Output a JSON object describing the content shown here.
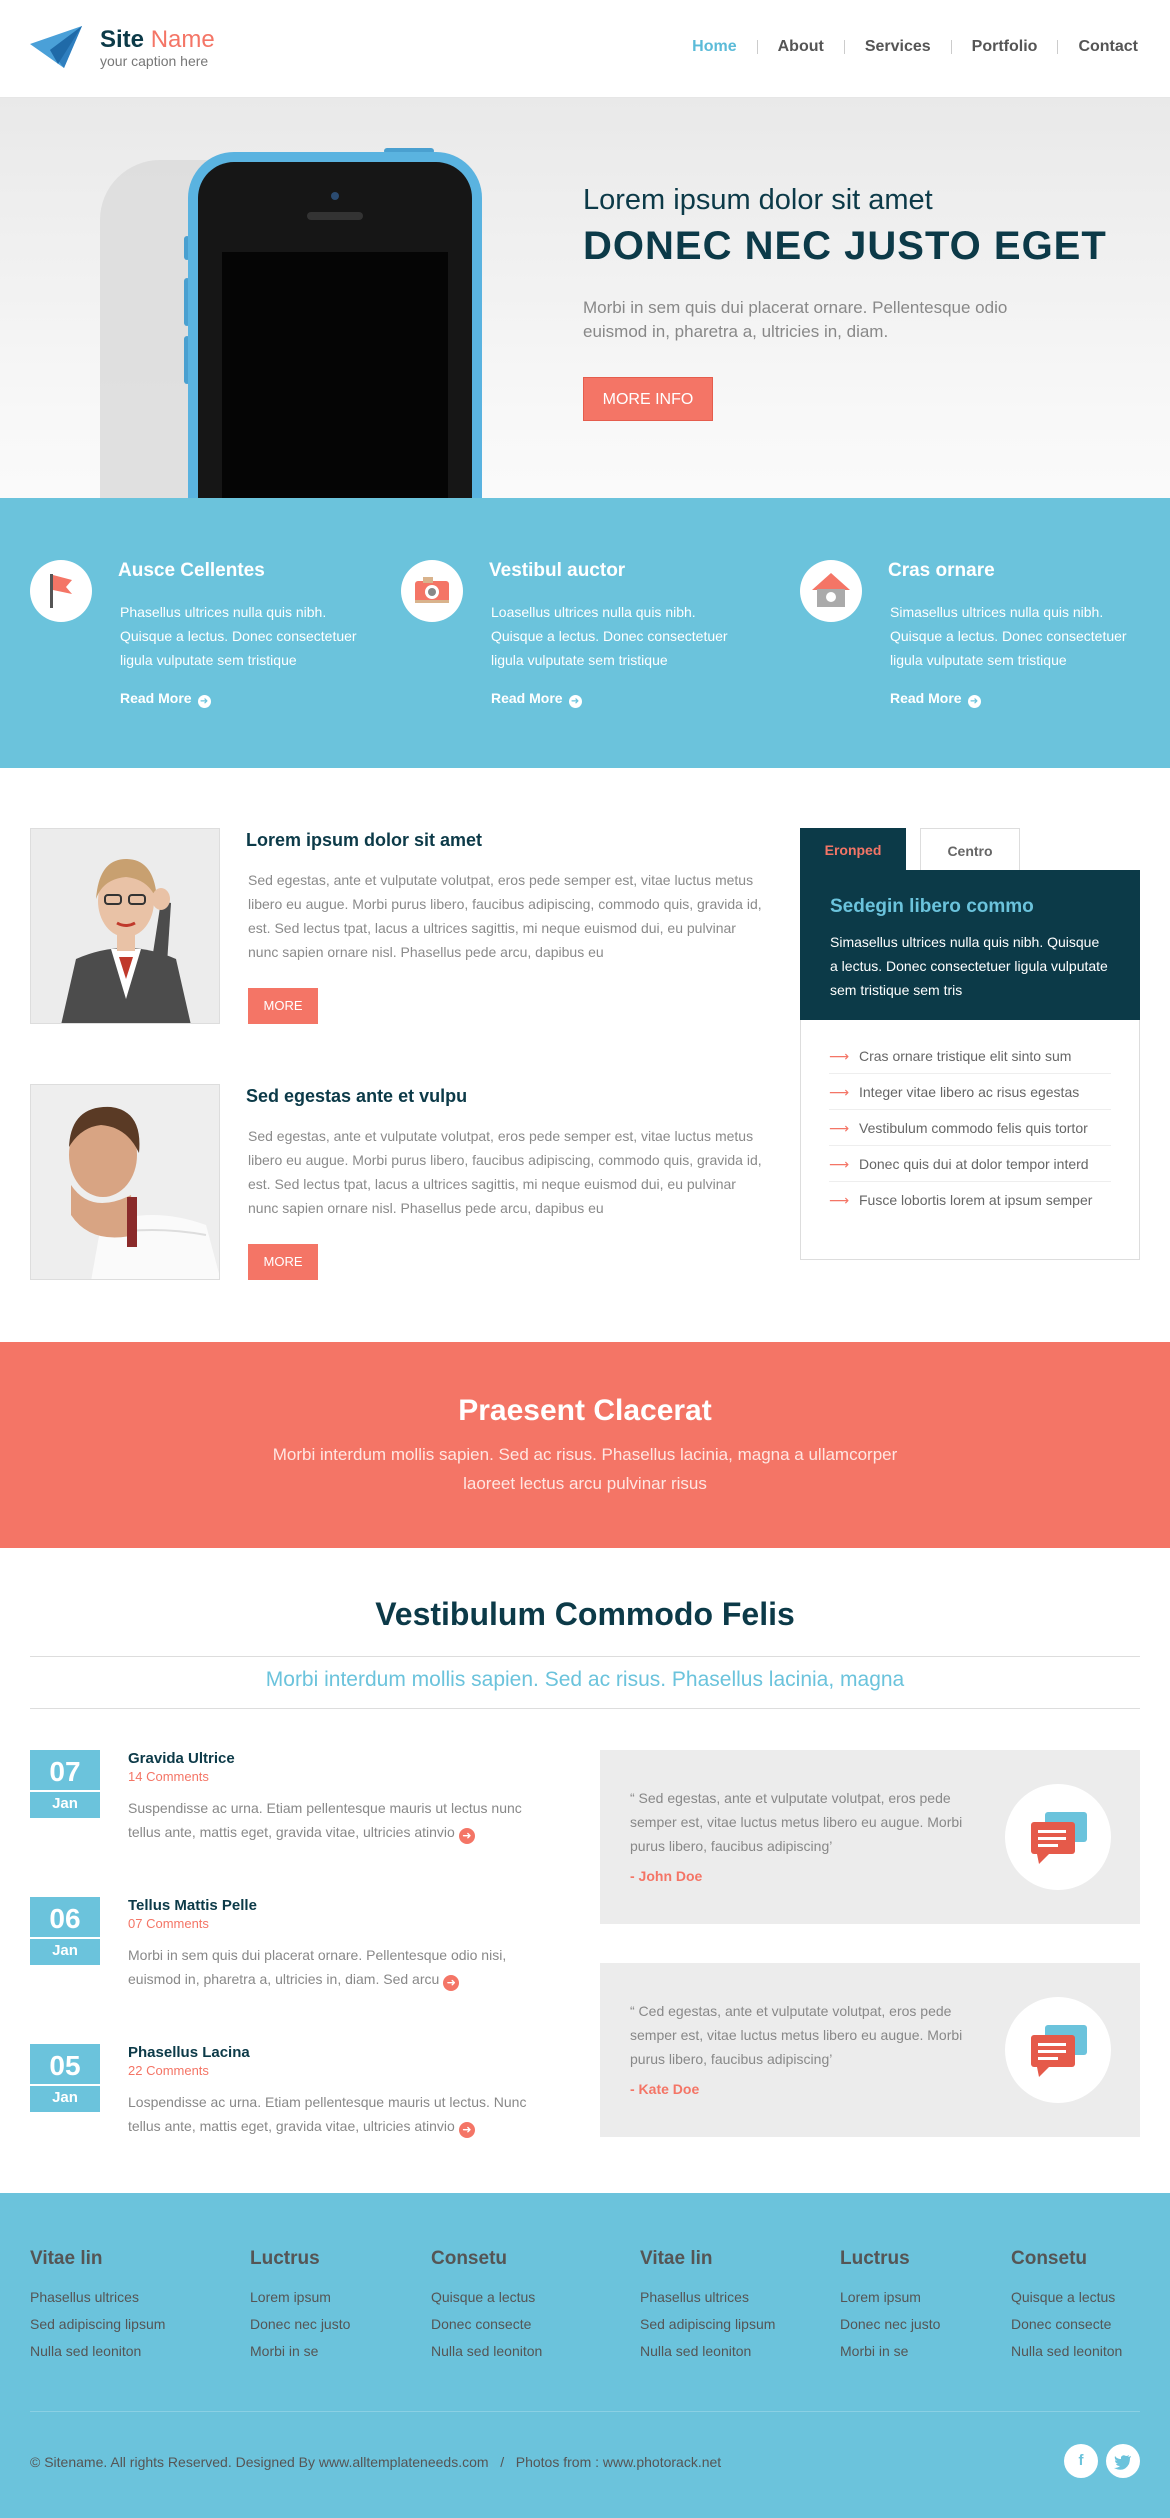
{
  "header": {
    "site_name_1": "Site",
    "site_name_2": "Name",
    "caption": "your caption here",
    "nav": [
      "Home",
      "About",
      "Services",
      "Portfolio",
      "Contact"
    ],
    "active_nav": "Home"
  },
  "hero": {
    "subtitle": "Lorem ipsum dolor sit amet",
    "title": "DONEC NEC JUSTO EGET",
    "text": "Morbi in sem quis dui placerat ornare. Pellentesque odio euismod in, pharetra a, ultricies in, diam.",
    "button": "MORE INFO"
  },
  "features": [
    {
      "title": "Ausce Cellentes",
      "text": "Phasellus ultrices nulla quis nibh. Quisque a lectus. Donec consectetuer ligula vulputate sem tristique",
      "link": "Read More",
      "icon": "flag-icon"
    },
    {
      "title": "Vestibul auctor",
      "text": "Loasellus ultrices nulla quis nibh. Quisque a lectus. Donec consectetuer ligula vulputate sem tristique",
      "link": "Read More",
      "icon": "camera-icon"
    },
    {
      "title": "Cras ornare",
      "text": "Simasellus ultrices nulla quis nibh. Quisque a lectus. Donec consectetuer ligula vulputate sem tristique",
      "link": "Read More",
      "icon": "home-icon"
    }
  ],
  "articles": [
    {
      "title": "Lorem ipsum dolor sit amet",
      "text": "Sed egestas, ante et vulputate volutpat, eros pede semper est, vitae luctus metus libero eu augue. Morbi purus libero, faucibus adipiscing, commodo quis, gravida id, est. Sed lectus tpat, lacus a ultrices sagittis, mi neque euismod dui, eu pulvinar nunc sapien ornare nisl. Phasellus pede arcu, dapibus eu",
      "button": "MORE"
    },
    {
      "title": "Sed egestas ante et vulpu",
      "text": "Sed egestas, ante et vulputate volutpat, eros pede semper est, vitae luctus metus libero eu augue. Morbi purus libero, faucibus adipiscing, commodo quis, gravida id, est. Sed lectus tpat, lacus a ultrices sagittis, mi neque euismod dui, eu pulvinar nunc sapien ornare nisl. Phasellus pede arcu, dapibus eu",
      "button": "MORE"
    }
  ],
  "tabs": {
    "labels": [
      "Eronped",
      "Centro"
    ],
    "panel_title": "Sedegin libero commo",
    "panel_text": "Simasellus ultrices nulla quis nibh. Quisque a lectus. Donec consectetuer ligula vulputate sem tristique sem tris",
    "list": [
      "Cras ornare tristique elit  sinto sum",
      "Integer vitae libero ac risus egestas",
      "Vestibulum commodo felis quis tortor",
      "Donec quis dui at dolor tempor interd",
      "Fusce lobortis lorem at ipsum semper"
    ]
  },
  "banner": {
    "title": "Praesent Clacerat",
    "text": "Morbi interdum mollis sapien. Sed ac risus. Phasellus lacinia, magna a ullamcorper laoreet lectus arcu pulvinar risus"
  },
  "section2": {
    "title": "Vestibulum Commodo Felis",
    "subtitle": "Morbi interdum mollis sapien. Sed ac risus. Phasellus lacinia, magna"
  },
  "posts": [
    {
      "day": "07",
      "month": "Jan",
      "title": "Gravida Ultrice",
      "comments": "14 Comments",
      "text": "Suspendisse ac urna. Etiam pellentesque mauris ut lectus nunc tellus ante, mattis eget, gravida vitae, ultricies atinvio"
    },
    {
      "day": "06",
      "month": "Jan",
      "title": "Tellus Mattis Pelle",
      "comments": "07 Comments",
      "text": "Morbi in sem quis dui placerat ornare. Pellentesque odio nisi, euismod in, pharetra a, ultricies in, diam. Sed arcu"
    },
    {
      "day": "05",
      "month": "Jan",
      "title": "Phasellus Lacina",
      "comments": "22 Comments",
      "text": "Lospendisse ac urna. Etiam pellentesque mauris ut lectus. Nunc tellus ante, mattis eget, gravida vitae, ultricies atinvio"
    }
  ],
  "quotes": [
    {
      "text": "“ Sed egestas, ante et vulputate volutpat, eros pede semper est, vitae luctus metus libero eu augue. Morbi purus libero, faucibus adipiscing’",
      "author": "- John Doe"
    },
    {
      "text": "“ Ced egestas, ante et vulputate volutpat, eros pede semper est, vitae luctus metus libero eu augue. Morbi purus libero, faucibus adipiscing’",
      "author": "- Kate Doe"
    }
  ],
  "footer": {
    "columns": [
      {
        "title": "Vitae lin",
        "links": [
          "Phasellus ultrices",
          "Sed adipiscing lipsum",
          "Nulla sed leoniton"
        ]
      },
      {
        "title": "Luctrus",
        "links": [
          "Lorem ipsum",
          "Donec nec justo",
          "Morbi in se"
        ]
      },
      {
        "title": "Consetu",
        "links": [
          "Quisque a lectus",
          "Donec consecte",
          "Nulla sed leoniton"
        ]
      },
      {
        "title": "Vitae lin",
        "links": [
          "Phasellus ultrices",
          "Sed adipiscing lipsum",
          "Nulla sed leoniton"
        ]
      },
      {
        "title": "Luctrus",
        "links": [
          "Lorem ipsum",
          "Donec nec justo",
          "Morbi in se"
        ]
      },
      {
        "title": "Consetu",
        "links": [
          "Quisque a lectus",
          "Donec consecte",
          "Nulla sed leoniton"
        ]
      }
    ],
    "copyright": "© Sitename. All rights Reserved. Designed By www.alltemplateneeds.com   /   Photos from : www.photorack.net",
    "social": [
      "facebook-icon",
      "twitter-icon"
    ]
  },
  "colors": {
    "accent": "#f47566",
    "blue": "#6bc3dc",
    "dark": "#0c3a48"
  }
}
